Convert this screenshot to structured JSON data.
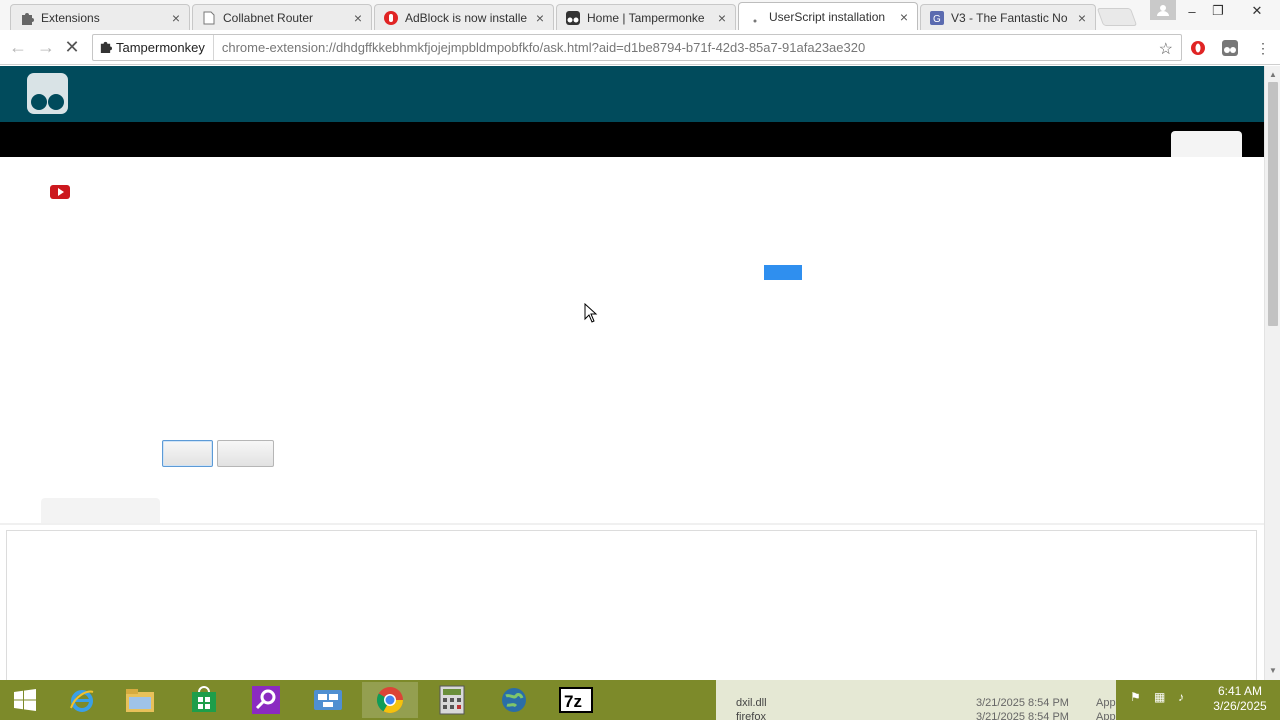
{
  "tabs": [
    {
      "title": "Extensions",
      "icon": "puzzle-icon",
      "active": false
    },
    {
      "title": "Collabnet Router",
      "icon": "page-icon",
      "active": false
    },
    {
      "title": "AdBlock is now installe",
      "icon": "adblock-icon",
      "active": false
    },
    {
      "title": "Home | Tampermonke",
      "icon": "tampermonkey-icon",
      "active": false
    },
    {
      "title": "UserScript installation",
      "icon": "loading-icon",
      "active": true
    },
    {
      "title": "V3 - The Fantastic No",
      "icon": "greasyfork-icon",
      "active": false
    }
  ],
  "toolbar": {
    "chip_label": "Tampermonkey",
    "url": "chrome-extension://dhdgffkkebhmkfjojejmpbldmpobfkfo/ask.html?aid=d1be8794-b71f-42d3-85a7-91afa23ae320"
  },
  "page": {
    "header_color": "#014b5c",
    "bar_color": "#000000",
    "accent_color": "#2f8fef"
  },
  "taskbar": {
    "apps": [
      {
        "name": "internet-explorer-icon"
      },
      {
        "name": "file-explorer-icon"
      },
      {
        "name": "store-icon"
      },
      {
        "name": "search-app-icon"
      },
      {
        "name": "network-app-icon"
      },
      {
        "name": "chrome-icon",
        "active": true
      },
      {
        "name": "calculator-app-icon"
      },
      {
        "name": "globe-app-icon"
      },
      {
        "name": "7zip-icon"
      }
    ],
    "files": [
      {
        "name": "dxil.dll",
        "date": "3/21/2025 8:54 PM",
        "type": "Applicati"
      },
      {
        "name": "firefox",
        "date": "3/21/2025 8:54 PM",
        "type": "Application"
      }
    ],
    "clock_time": "6:41 AM",
    "clock_date": "3/26/2025"
  }
}
